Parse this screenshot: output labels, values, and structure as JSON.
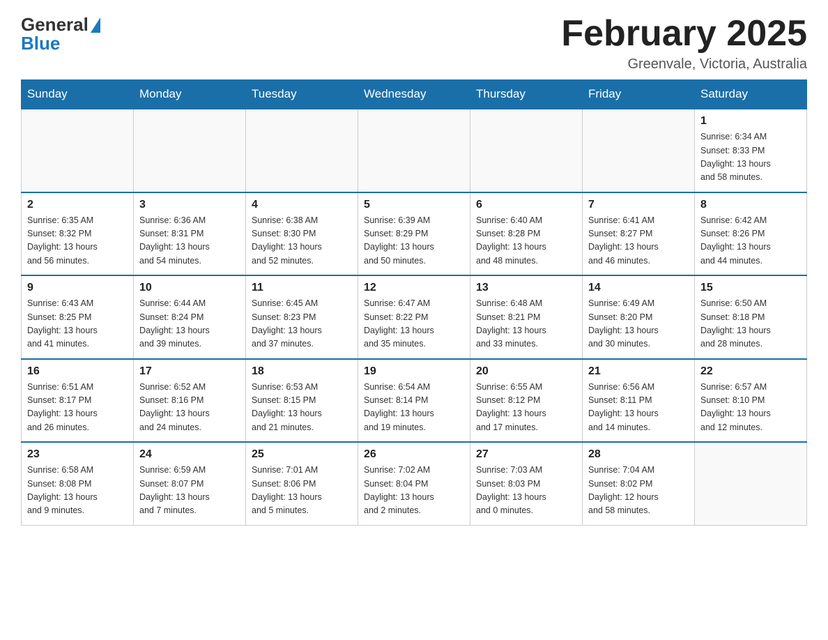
{
  "header": {
    "logo": {
      "general": "General",
      "blue": "Blue"
    },
    "title": "February 2025",
    "location": "Greenvale, Victoria, Australia"
  },
  "weekdays": [
    "Sunday",
    "Monday",
    "Tuesday",
    "Wednesday",
    "Thursday",
    "Friday",
    "Saturday"
  ],
  "weeks": [
    [
      {
        "day": "",
        "info": ""
      },
      {
        "day": "",
        "info": ""
      },
      {
        "day": "",
        "info": ""
      },
      {
        "day": "",
        "info": ""
      },
      {
        "day": "",
        "info": ""
      },
      {
        "day": "",
        "info": ""
      },
      {
        "day": "1",
        "info": "Sunrise: 6:34 AM\nSunset: 8:33 PM\nDaylight: 13 hours\nand 58 minutes."
      }
    ],
    [
      {
        "day": "2",
        "info": "Sunrise: 6:35 AM\nSunset: 8:32 PM\nDaylight: 13 hours\nand 56 minutes."
      },
      {
        "day": "3",
        "info": "Sunrise: 6:36 AM\nSunset: 8:31 PM\nDaylight: 13 hours\nand 54 minutes."
      },
      {
        "day": "4",
        "info": "Sunrise: 6:38 AM\nSunset: 8:30 PM\nDaylight: 13 hours\nand 52 minutes."
      },
      {
        "day": "5",
        "info": "Sunrise: 6:39 AM\nSunset: 8:29 PM\nDaylight: 13 hours\nand 50 minutes."
      },
      {
        "day": "6",
        "info": "Sunrise: 6:40 AM\nSunset: 8:28 PM\nDaylight: 13 hours\nand 48 minutes."
      },
      {
        "day": "7",
        "info": "Sunrise: 6:41 AM\nSunset: 8:27 PM\nDaylight: 13 hours\nand 46 minutes."
      },
      {
        "day": "8",
        "info": "Sunrise: 6:42 AM\nSunset: 8:26 PM\nDaylight: 13 hours\nand 44 minutes."
      }
    ],
    [
      {
        "day": "9",
        "info": "Sunrise: 6:43 AM\nSunset: 8:25 PM\nDaylight: 13 hours\nand 41 minutes."
      },
      {
        "day": "10",
        "info": "Sunrise: 6:44 AM\nSunset: 8:24 PM\nDaylight: 13 hours\nand 39 minutes."
      },
      {
        "day": "11",
        "info": "Sunrise: 6:45 AM\nSunset: 8:23 PM\nDaylight: 13 hours\nand 37 minutes."
      },
      {
        "day": "12",
        "info": "Sunrise: 6:47 AM\nSunset: 8:22 PM\nDaylight: 13 hours\nand 35 minutes."
      },
      {
        "day": "13",
        "info": "Sunrise: 6:48 AM\nSunset: 8:21 PM\nDaylight: 13 hours\nand 33 minutes."
      },
      {
        "day": "14",
        "info": "Sunrise: 6:49 AM\nSunset: 8:20 PM\nDaylight: 13 hours\nand 30 minutes."
      },
      {
        "day": "15",
        "info": "Sunrise: 6:50 AM\nSunset: 8:18 PM\nDaylight: 13 hours\nand 28 minutes."
      }
    ],
    [
      {
        "day": "16",
        "info": "Sunrise: 6:51 AM\nSunset: 8:17 PM\nDaylight: 13 hours\nand 26 minutes."
      },
      {
        "day": "17",
        "info": "Sunrise: 6:52 AM\nSunset: 8:16 PM\nDaylight: 13 hours\nand 24 minutes."
      },
      {
        "day": "18",
        "info": "Sunrise: 6:53 AM\nSunset: 8:15 PM\nDaylight: 13 hours\nand 21 minutes."
      },
      {
        "day": "19",
        "info": "Sunrise: 6:54 AM\nSunset: 8:14 PM\nDaylight: 13 hours\nand 19 minutes."
      },
      {
        "day": "20",
        "info": "Sunrise: 6:55 AM\nSunset: 8:12 PM\nDaylight: 13 hours\nand 17 minutes."
      },
      {
        "day": "21",
        "info": "Sunrise: 6:56 AM\nSunset: 8:11 PM\nDaylight: 13 hours\nand 14 minutes."
      },
      {
        "day": "22",
        "info": "Sunrise: 6:57 AM\nSunset: 8:10 PM\nDaylight: 13 hours\nand 12 minutes."
      }
    ],
    [
      {
        "day": "23",
        "info": "Sunrise: 6:58 AM\nSunset: 8:08 PM\nDaylight: 13 hours\nand 9 minutes."
      },
      {
        "day": "24",
        "info": "Sunrise: 6:59 AM\nSunset: 8:07 PM\nDaylight: 13 hours\nand 7 minutes."
      },
      {
        "day": "25",
        "info": "Sunrise: 7:01 AM\nSunset: 8:06 PM\nDaylight: 13 hours\nand 5 minutes."
      },
      {
        "day": "26",
        "info": "Sunrise: 7:02 AM\nSunset: 8:04 PM\nDaylight: 13 hours\nand 2 minutes."
      },
      {
        "day": "27",
        "info": "Sunrise: 7:03 AM\nSunset: 8:03 PM\nDaylight: 13 hours\nand 0 minutes."
      },
      {
        "day": "28",
        "info": "Sunrise: 7:04 AM\nSunset: 8:02 PM\nDaylight: 12 hours\nand 58 minutes."
      },
      {
        "day": "",
        "info": ""
      }
    ]
  ]
}
